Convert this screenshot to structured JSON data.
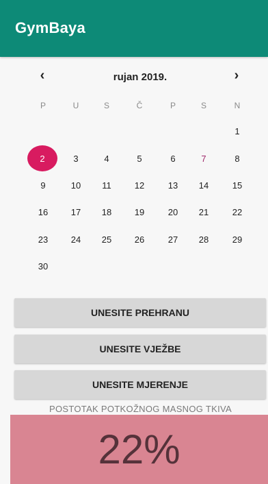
{
  "app": {
    "title": "GymBaya"
  },
  "colors": {
    "app_bar": "#0d8a77",
    "selected_day": "#d81b60",
    "saturday_text": "#a0296b",
    "fat_panel": "#d98592"
  },
  "calendar": {
    "month_label": "rujan 2019.",
    "prev_icon": "chevron-left-icon",
    "next_icon": "chevron-right-icon",
    "weekdays": [
      "P",
      "U",
      "S",
      "Č",
      "P",
      "S",
      "N"
    ],
    "selected_day": "2",
    "days": [
      "1",
      "2",
      "3",
      "4",
      "5",
      "6",
      "7",
      "8",
      "9",
      "10",
      "11",
      "12",
      "13",
      "14",
      "15",
      "16",
      "17",
      "18",
      "19",
      "20",
      "21",
      "22",
      "23",
      "24",
      "25",
      "26",
      "27",
      "28",
      "29",
      "30"
    ]
  },
  "buttons": {
    "food": "UNESITE PREHRANU",
    "exercise": "UNESITE VJEŽBE",
    "measurement": "UNESITE MJERENJE"
  },
  "fat": {
    "label": "POSTOTAK POTKOŽNOG MASNOG TKIVA",
    "value": "22%"
  }
}
